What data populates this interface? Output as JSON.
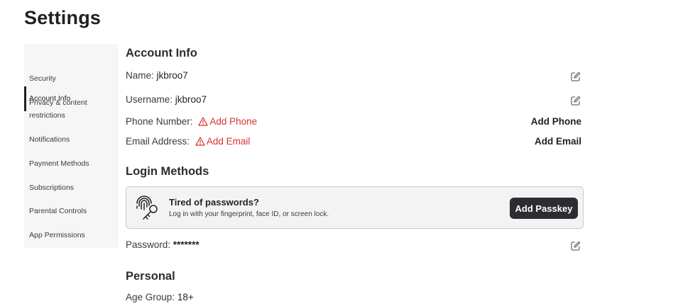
{
  "page": {
    "title": "Settings"
  },
  "sidebar": {
    "items": [
      {
        "label": "Account Info",
        "active": true
      },
      {
        "label": "Security"
      },
      {
        "label": "Privacy & content\nrestrictions"
      },
      {
        "label": "Notifications"
      },
      {
        "label": "Payment Methods"
      },
      {
        "label": "Subscriptions"
      },
      {
        "label": "Parental Controls"
      },
      {
        "label": "App Permissions"
      }
    ]
  },
  "account_info": {
    "title": "Account Info",
    "name_label": "Name:",
    "name_value": "jkbroo7",
    "username_label": "Username:",
    "username_value": "jkbroo7",
    "phone_label": "Phone Number:",
    "phone_warning": "Add Phone",
    "phone_action": "Add Phone",
    "email_label": "Email Address:",
    "email_warning": "Add Email",
    "email_action": "Add Email"
  },
  "login_methods": {
    "title": "Login Methods",
    "card_title": "Tired of passwords?",
    "card_subtitle": "Log in with your fingerprint, face ID, or screen lock.",
    "button_label": "Add Passkey",
    "password_label": "Password:",
    "password_value": "*******"
  },
  "personal": {
    "title": "Personal",
    "age_group_label": "Age Group:",
    "age_group_value": "18+"
  },
  "icons": {
    "edit": "pencil-square-icon",
    "warning": "warning-triangle-icon",
    "passkey": "fingerprint-key-icon"
  },
  "colors": {
    "warning": "#d6362d",
    "button_bg": "#2b2d30",
    "sidebar_bg": "#f6f6f6"
  }
}
